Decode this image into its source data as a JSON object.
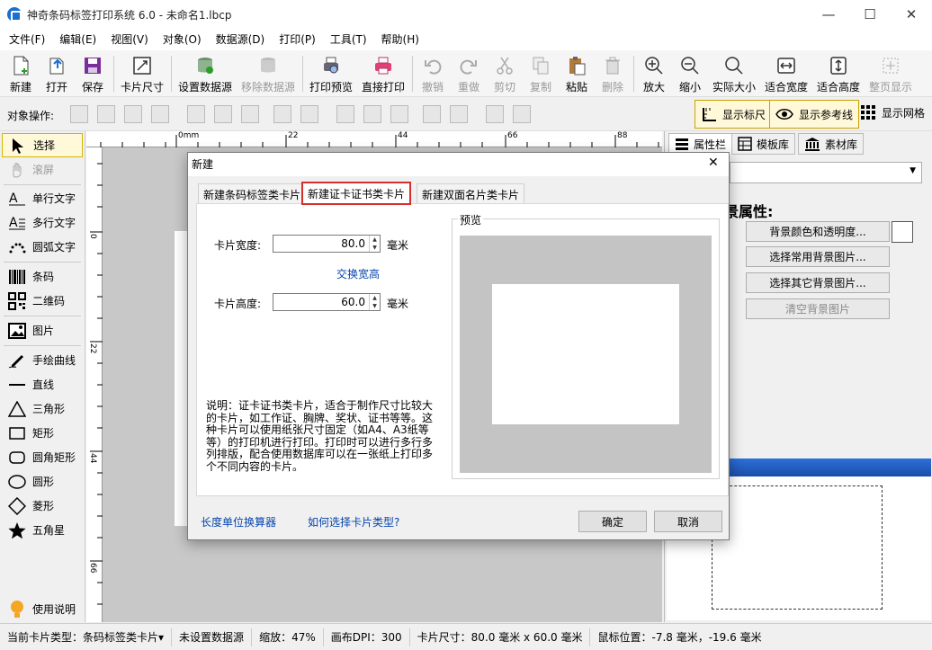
{
  "window": {
    "title": "神奇条码标签打印系统 6.0 - 未命名1.lbcp",
    "minimize": "—",
    "maximize": "☐",
    "close": "✕"
  },
  "menu": [
    "文件(F)",
    "编辑(E)",
    "视图(V)",
    "对象(O)",
    "数据源(D)",
    "打印(P)",
    "工具(T)",
    "帮助(H)"
  ],
  "toolbar": {
    "new": "新建",
    "open": "打开",
    "save": "保存",
    "card_size": "卡片尺寸",
    "set_datasource": "设置数据源",
    "remove_datasource": "移除数据源",
    "print_preview": "打印预览",
    "direct_print": "直接打印",
    "undo": "撤销",
    "redo": "重做",
    "cut": "剪切",
    "copy": "复制",
    "paste": "粘贴",
    "delete": "删除",
    "zoom_in": "放大",
    "zoom_out": "缩小",
    "actual_size": "实际大小",
    "fit_width": "适合宽度",
    "fit_height": "适合高度",
    "full_page": "整页显示"
  },
  "objbar": {
    "label": "对象操作:",
    "show_ruler": "显示标尺",
    "show_guides": "显示参考线",
    "show_grid": "显示网格"
  },
  "lefttools": {
    "select": "选择",
    "scroll": "滚屏",
    "single_text": "单行文字",
    "multi_text": "多行文字",
    "arc_text": "圆弧文字",
    "barcode": "条码",
    "qrcode": "二维码",
    "image": "图片",
    "freehand": "手绘曲线",
    "line": "直线",
    "triangle": "三角形",
    "rectangle": "矩形",
    "round_rect": "圆角矩形",
    "ellipse": "圆形",
    "diamond": "菱形",
    "star": "五角星",
    "help": "使用说明"
  },
  "ruler": {
    "top": [
      "0mm",
      "22",
      "44",
      "66",
      "88"
    ],
    "left": [
      "0",
      "22",
      "44",
      "66"
    ]
  },
  "rightpanel": {
    "tabs": [
      "属性栏",
      "模板库",
      "素材库"
    ],
    "bg_title": "景属性:",
    "bg_color_btn": "背景颜色和透明度...",
    "common_bg_btn": "选择常用背景图片...",
    "other_bg_btn": "选择其它背景图片...",
    "clear_bg_btn": "清空背景图片"
  },
  "dialog": {
    "title": "新建",
    "close": "✕",
    "tabs": [
      "新建条码标签类卡片",
      "新建证卡证书类卡片",
      "新建双面名片类卡片"
    ],
    "width_label": "卡片宽度:",
    "width_value": "80.0",
    "width_unit": "毫米",
    "swap_link": "交换宽高",
    "height_label": "卡片高度:",
    "height_value": "60.0",
    "height_unit": "毫米",
    "preview_label": "预览",
    "description": "说明：证卡证书类卡片，适合于制作尺寸比较大的卡片，如工作证、胸牌、奖状、证书等等。这种卡片可以使用纸张尺寸固定（如A4、A3纸等等）的打印机进行打印。打印时可以进行多行多列排版，配合使用数据库可以在一张纸上打印多个不同内容的卡片。",
    "length_converter_link": "长度单位换算器",
    "how_to_choose_link": "如何选择卡片类型?",
    "ok": "确定",
    "cancel": "取消",
    "preview_card_width_mm": 80.0,
    "preview_card_height_mm": 60.0
  },
  "status": {
    "card_type": "当前卡片类型：条码标签类卡片",
    "card_type_arrow": "▾",
    "datasource": "未设置数据源",
    "zoom": "缩放：47%",
    "dpi": "画布DPI：300",
    "card_size": "卡片尺寸：80.0 毫米 x 60.0 毫米",
    "mouse": "鼠标位置：-7.8 毫米，-19.6 毫米"
  }
}
